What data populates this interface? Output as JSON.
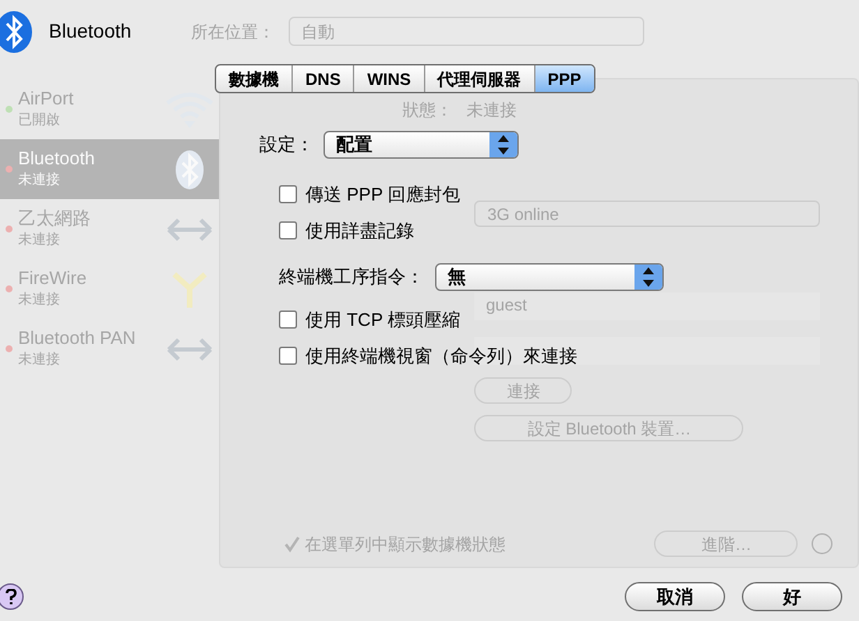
{
  "window": {
    "title": "Bluetooth"
  },
  "background": {
    "location_label": "所在位置：",
    "location_value": "自動",
    "services": [
      {
        "name": "AirPort",
        "status": "已開啟",
        "selected": false,
        "color": "#bfe0b5",
        "kind": "wifi"
      },
      {
        "name": "Bluetooth",
        "status": "未連接",
        "selected": true,
        "color": "#ecb0b0",
        "kind": "bluetooth"
      },
      {
        "name": "乙太網路",
        "status": "未連接",
        "selected": false,
        "color": "#ecb0b0",
        "kind": "arrows"
      },
      {
        "name": "FireWire",
        "status": "未連接",
        "selected": false,
        "color": "#ecb0b0",
        "kind": "firewire"
      },
      {
        "name": "Bluetooth PAN",
        "status": "未連接",
        "selected": false,
        "color": "#ecb0b0",
        "kind": "arrows"
      }
    ],
    "status_label": "狀態：",
    "status_value": "未連接",
    "fields": [
      "3G online",
      "guest"
    ],
    "connect_button": "連接",
    "setup_button": "設定 Bluetooth 裝置…",
    "show_status": {
      "label": "在選單列中顯示數據機狀態",
      "checked": true
    },
    "advanced_button": "進階…"
  },
  "tabs": [
    {
      "label": "數據機",
      "selected": false
    },
    {
      "label": "DNS",
      "selected": false
    },
    {
      "label": "WINS",
      "selected": false
    },
    {
      "label": "代理伺服器",
      "selected": false
    },
    {
      "label": "PPP",
      "selected": true
    }
  ],
  "settings": {
    "label": "設定：",
    "value": "配置"
  },
  "options": [
    {
      "kind": "checkbox",
      "label": "傳送 PPP 回應封包",
      "checked": false
    },
    {
      "kind": "checkbox",
      "label": "使用詳盡記錄",
      "checked": false
    },
    {
      "kind": "popup",
      "label": "終端機工序指令：",
      "value": "無"
    },
    {
      "kind": "checkbox",
      "label": "使用 TCP 標頭壓縮",
      "checked": false
    },
    {
      "kind": "checkbox",
      "label": "使用終端機視窗（命令列）來連接",
      "checked": false
    }
  ],
  "buttons": [
    {
      "label": "取消"
    },
    {
      "label": "好"
    }
  ]
}
